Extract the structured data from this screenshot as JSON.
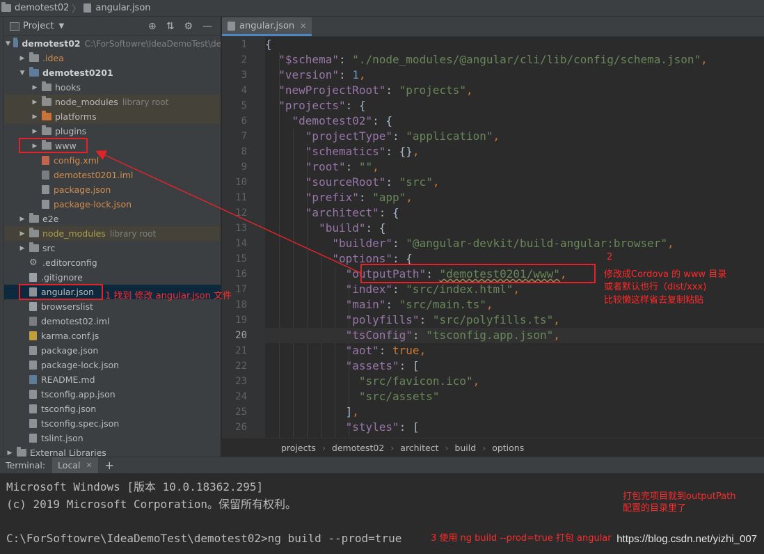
{
  "topbar": {
    "project": "demotest02",
    "file": "angular.json"
  },
  "project_panel": {
    "title": "Project",
    "tools": [
      "locate-icon",
      "collapse-icon",
      "gear-icon",
      "minimize-icon"
    ],
    "root": {
      "name": "demotest02",
      "path": "C:\\ForSoftowre\\IdeaDemoTest\\de"
    },
    "items": [
      {
        "label": "idea",
        "prefix": ".",
        "hint": ""
      },
      {
        "label": "demotest0201",
        "hint": ""
      },
      {
        "label": "hooks",
        "hint": ""
      },
      {
        "label": "node_modules",
        "hint": "library root"
      },
      {
        "label": "platforms",
        "hint": ""
      },
      {
        "label": "plugins",
        "hint": ""
      },
      {
        "label": "www",
        "hint": ""
      },
      {
        "label": "config.xml",
        "hint": ""
      },
      {
        "label": "demotest0201.iml",
        "hint": ""
      },
      {
        "label": "package.json",
        "hint": ""
      },
      {
        "label": "package-lock.json",
        "hint": ""
      },
      {
        "label": "e2e",
        "hint": ""
      },
      {
        "label": "node_modules",
        "hint": "library root"
      },
      {
        "label": "src",
        "hint": ""
      },
      {
        "label": ".editorconfig",
        "hint": ""
      },
      {
        "label": ".gitignore",
        "hint": ""
      },
      {
        "label": "angular.json",
        "hint": ""
      },
      {
        "label": "browserslist",
        "hint": ""
      },
      {
        "label": "demotest02.iml",
        "hint": ""
      },
      {
        "label": "karma.conf.js",
        "hint": ""
      },
      {
        "label": "package.json",
        "hint": ""
      },
      {
        "label": "package-lock.json",
        "hint": ""
      },
      {
        "label": "README.md",
        "hint": ""
      },
      {
        "label": "tsconfig.app.json",
        "hint": ""
      },
      {
        "label": "tsconfig.json",
        "hint": ""
      },
      {
        "label": "tsconfig.spec.json",
        "hint": ""
      },
      {
        "label": "tslint.json",
        "hint": ""
      },
      {
        "label": "External Libraries",
        "hint": ""
      }
    ]
  },
  "editor": {
    "tab": "angular.json",
    "line_numbers": [
      "1",
      "2",
      "3",
      "4",
      "5",
      "6",
      "7",
      "8",
      "9",
      "10",
      "11",
      "12",
      "13",
      "14",
      "15",
      "16",
      "17",
      "18",
      "19",
      "20",
      "21",
      "22",
      "23",
      "24",
      "25",
      "26"
    ],
    "current_line": 20,
    "breadcrumbs": [
      "projects",
      "demotest02",
      "architect",
      "build",
      "options"
    ]
  },
  "terminal": {
    "label": "Terminal:",
    "tab": "Local",
    "lines": [
      "Microsoft Windows [版本 10.0.18362.295]",
      "(c) 2019 Microsoft Corporation。保留所有权利。",
      "",
      "C:\\ForSoftowre\\IdeaDemoTest\\demotest02>ng build --prod=true"
    ]
  },
  "annotations": {
    "a1": "1 找到 修改 angular.json 文件",
    "a2_num": "2",
    "a2_l1": "修改成Cordova 的 www 目录",
    "a2_l2": "或者默认也行（dist/xxx)",
    "a2_l3": "比较懒这样省去复制粘贴",
    "a3_l1": "打包完项目就到outputPath",
    "a3_l2": "配置的目录里了",
    "a4": "3 使用 ng build --prod=true  打包 angular"
  },
  "watermark": "https://blog.csdn.net/yizhi_007",
  "colors": {
    "annotation_red": "#ff2a2a",
    "accent_blue": "#4a88c7"
  }
}
